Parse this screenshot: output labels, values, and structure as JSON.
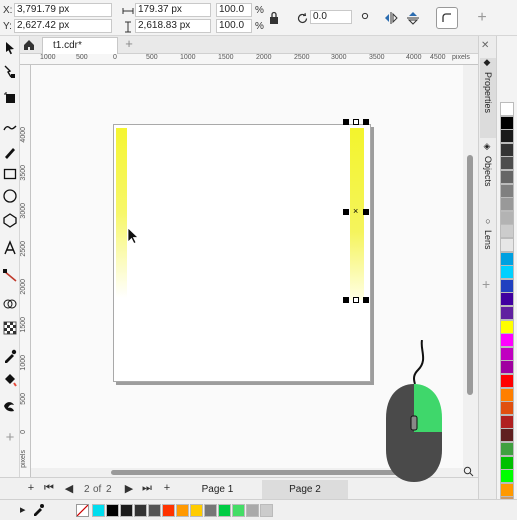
{
  "propbar": {
    "x_label": "X:",
    "x_value": "3,791.79 px",
    "y_label": "Y:",
    "y_value": "2,627.42 px",
    "w_value": "179.37 px",
    "h_value": "2,618.83 px",
    "scale_w": "100.0",
    "scale_h": "100.0",
    "pct": "%",
    "angle": "0.0"
  },
  "tabs": {
    "doc_tab": "t1.cdr*"
  },
  "ruler": {
    "units": "pixels",
    "h_labels": [
      "1000",
      "500",
      "0",
      "500",
      "1000",
      "1500",
      "2000",
      "2500",
      "3000",
      "3500",
      "4000",
      "4500"
    ],
    "v_labels": [
      "4000",
      "3500",
      "3000",
      "2500",
      "2000",
      "1500",
      "1000",
      "500",
      "0"
    ],
    "v_units": "pixels"
  },
  "dock": {
    "properties": "Properties",
    "objects": "Objects",
    "lens": "Lens"
  },
  "pages": {
    "current": "2",
    "of": "of",
    "total": "2",
    "page1": "Page 1",
    "page2": "Page 2"
  },
  "colors": {
    "accent_green": "#3fd76b",
    "glow_yellow": "#f3f42c"
  },
  "palette": [
    "#ffffff",
    "#000000",
    "#1a1a1a",
    "#333333",
    "#4d4d4d",
    "#666666",
    "#808080",
    "#999999",
    "#b3b3b3",
    "#cccccc",
    "#e6e6e6",
    "#00a0e0",
    "#00d0ff",
    "#2040c0",
    "#4000a0",
    "#6020a0",
    "#ffff00",
    "#ff00ff",
    "#c000c0",
    "#a000a0",
    "#ff0000",
    "#ff7f00",
    "#e05010",
    "#b02020",
    "#602020",
    "#40a040",
    "#00c000",
    "#00ff00",
    "#ff9900",
    "#cc9966",
    "#996633"
  ],
  "docpalette": [
    "#00ddee",
    "#000000",
    "#1a1a1a",
    "#333333",
    "#555555",
    "#ff3300",
    "#ff9900",
    "#ffcc00",
    "#777777",
    "#00cc44",
    "#44dd66",
    "#aaaaaa",
    "#cccccc"
  ]
}
